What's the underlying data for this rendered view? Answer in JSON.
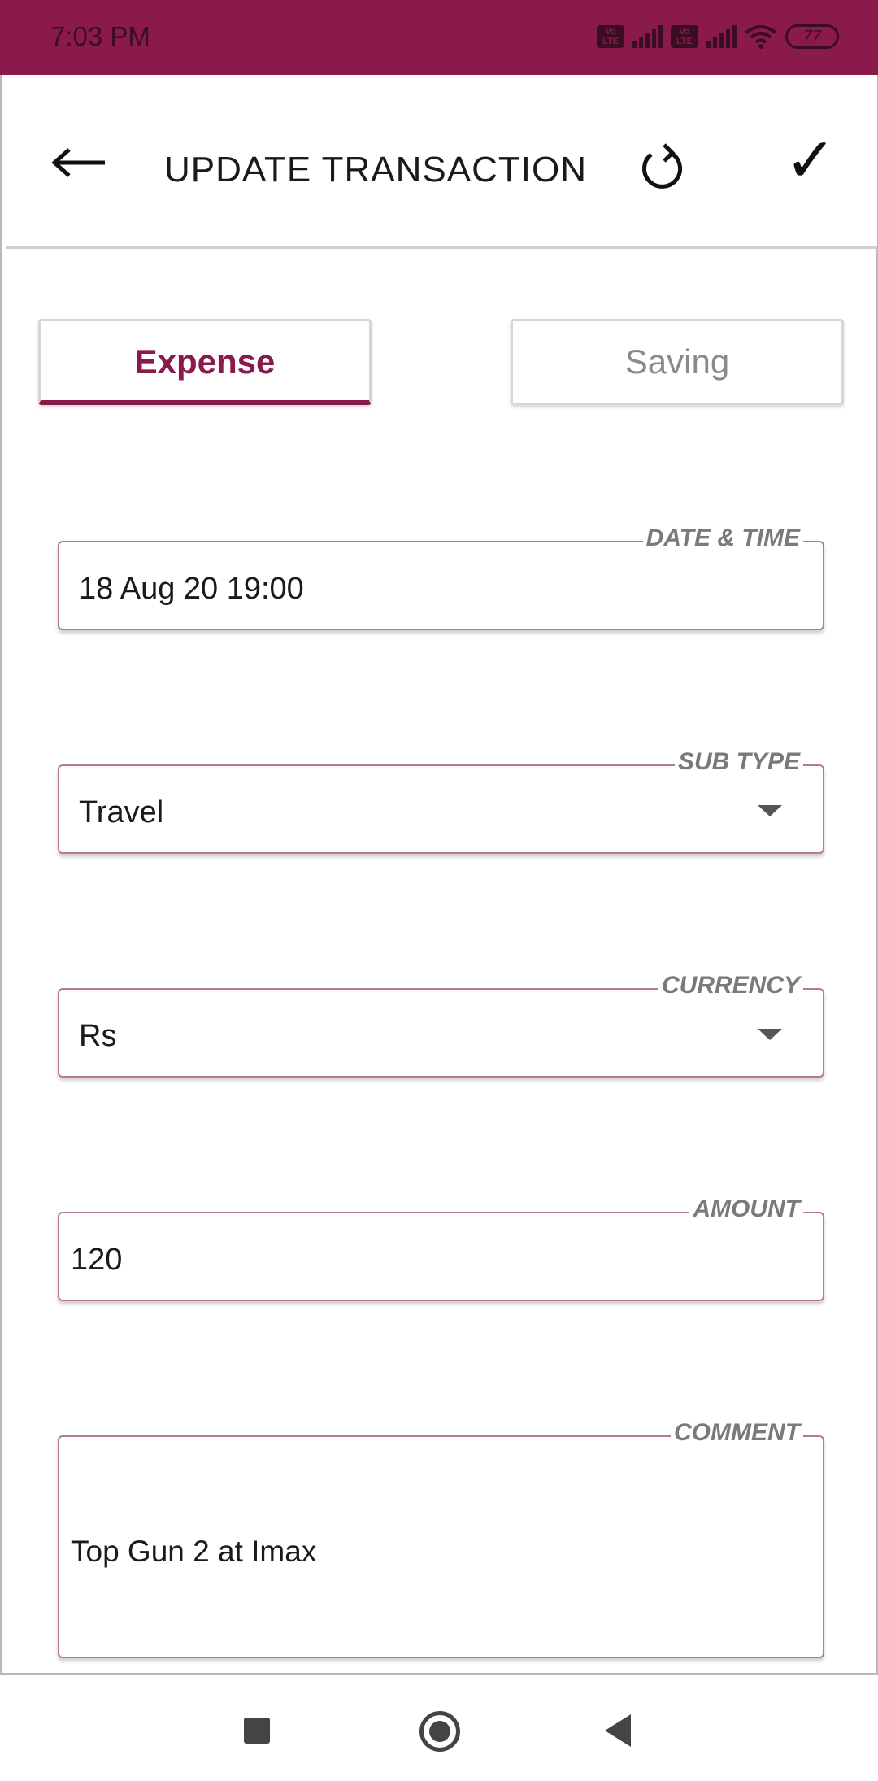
{
  "status_bar": {
    "time": "7:03 PM",
    "volte_1": "Vo LTE",
    "volte_2": "Vo LTE",
    "battery": "77"
  },
  "app_bar": {
    "title": "UPDATE TRANSACTION",
    "back_icon": "arrow-left-icon",
    "undo_icon": "undo-icon",
    "confirm_icon": "check-icon",
    "confirm_glyph": "✓"
  },
  "tabs": [
    {
      "label": "Expense",
      "selected": true
    },
    {
      "label": "Saving",
      "selected": false
    }
  ],
  "form": {
    "date_time": {
      "label": "DATE & TIME",
      "value": "18 Aug 20  19:00"
    },
    "sub_type": {
      "label": "SUB TYPE",
      "value": "Travel"
    },
    "currency": {
      "label": "CURRENCY",
      "value": "Rs"
    },
    "amount": {
      "label": "AMOUNT",
      "value": "120"
    },
    "comment": {
      "label": "COMMENT",
      "value": "Top Gun 2 at Imax"
    }
  },
  "colors": {
    "accent": "#8a1a4c",
    "field_border": "#b47a92"
  }
}
